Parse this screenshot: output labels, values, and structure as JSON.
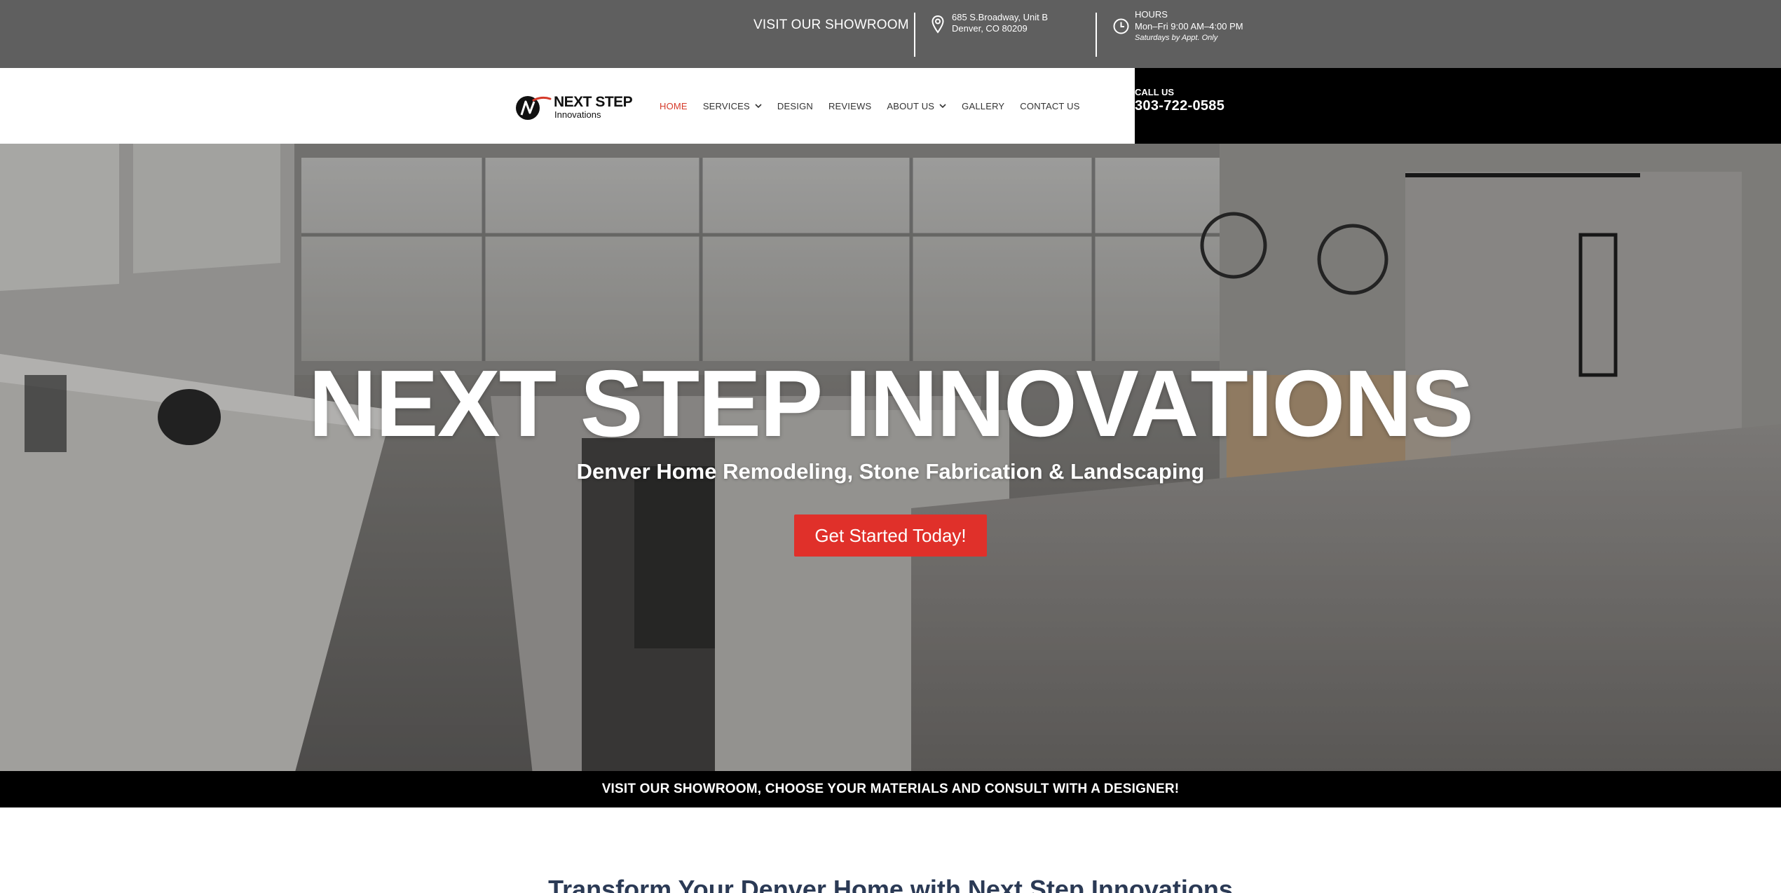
{
  "topbar": {
    "showroom_label": "VISIT OUR SHOWROOM",
    "address_line1": "685 S.Broadway, Unit B",
    "address_line2": "Denver, CO 80209",
    "hours_title": "HOURS",
    "hours_line": "Mon–Fri 9:00 AM–4:00 PM",
    "hours_note": "Saturdays by Appt. Only",
    "icons": [
      "map-pin-icon",
      "clock-icon"
    ]
  },
  "header": {
    "logo_line1": "NEXT STEP",
    "logo_line2": "Innovations",
    "nav": [
      {
        "label": "HOME",
        "active": true
      },
      {
        "label": "SERVICES",
        "dropdown": true
      },
      {
        "label": "DESIGN"
      },
      {
        "label": "REVIEWS"
      },
      {
        "label": "ABOUT US",
        "dropdown": true
      },
      {
        "label": "GALLERY"
      },
      {
        "label": "CONTACT US"
      }
    ],
    "call_label": "CALL US",
    "call_number": "303-722-0585"
  },
  "hero": {
    "title": "NEXT STEP INNOVATIONS",
    "subtitle": "Denver Home Remodeling, Stone Fabrication & Landscaping",
    "cta_label": "Get Started Today!"
  },
  "strip": {
    "text": "VISIT OUR SHOWROOM, CHOOSE YOUR MATERIALS AND CONSULT WITH A DESIGNER!"
  },
  "section": {
    "title": "Transform Your Denver Home with Next Step Innovations"
  },
  "colors": {
    "topbar_bg": "#5f5f5f",
    "accent_red": "#e0302a",
    "nav_active": "#d63a2a",
    "heading_navy": "#2b3a55"
  }
}
